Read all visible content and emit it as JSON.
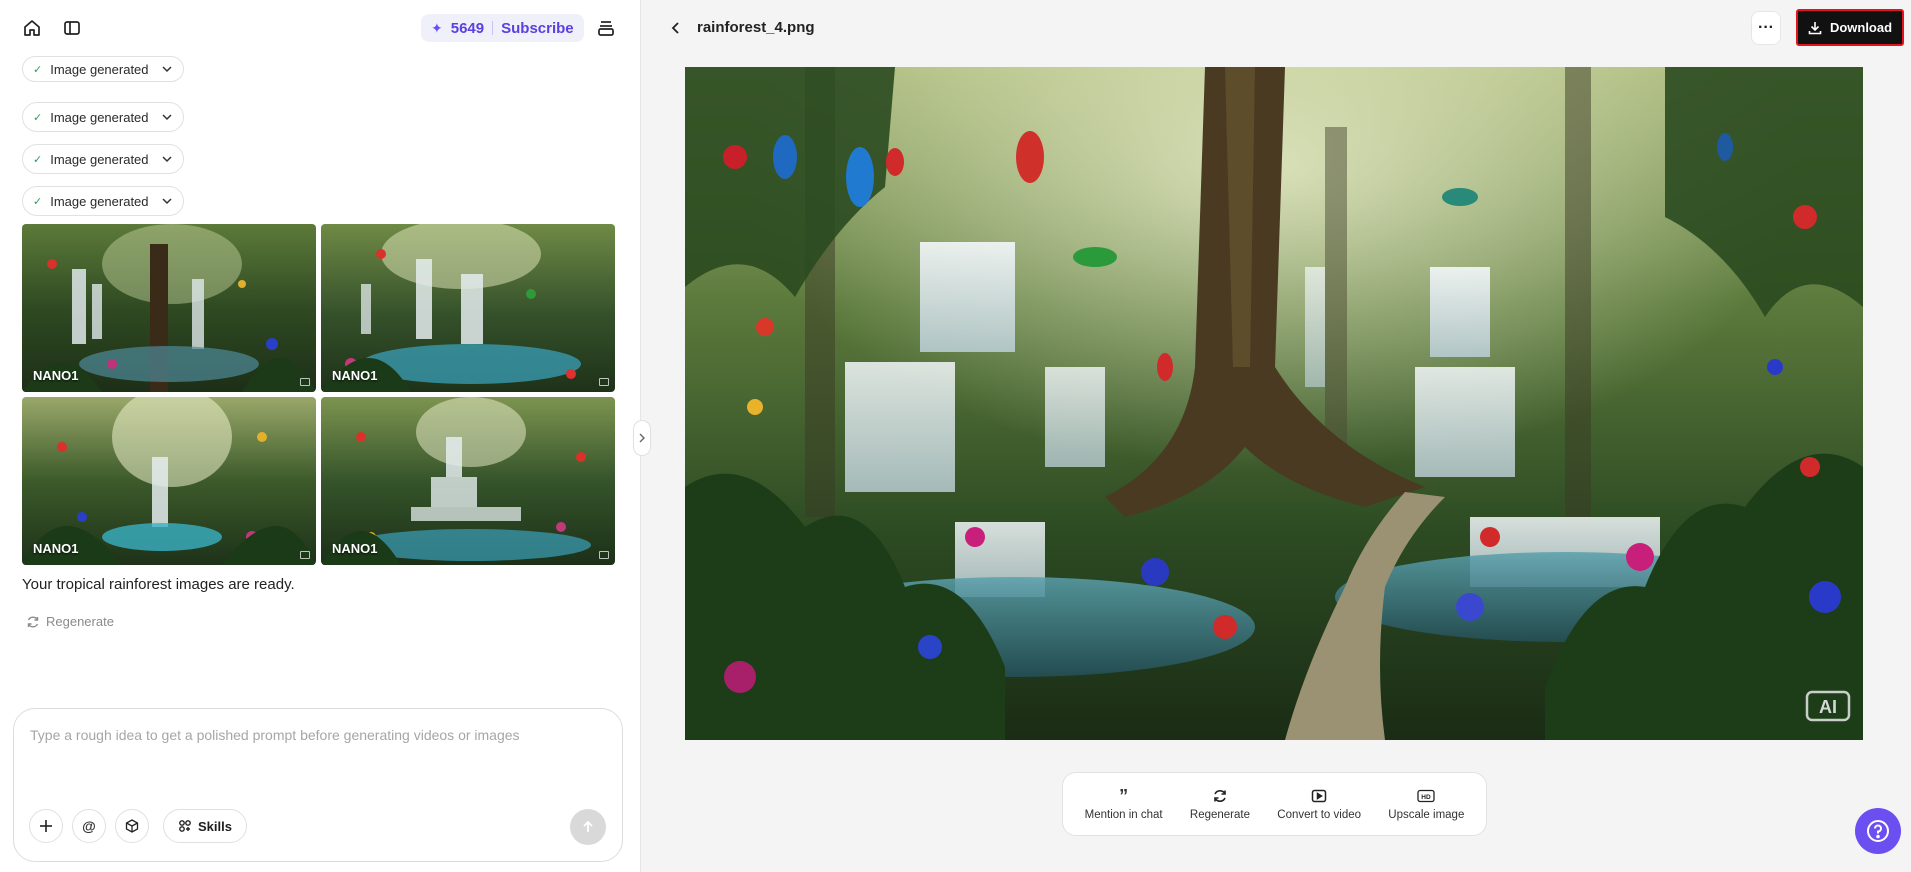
{
  "left_panel": {
    "credits": {
      "count": "5649",
      "subscribe_label": "Subscribe"
    },
    "chips": [
      {
        "label": "Image generated"
      },
      {
        "label": "Image generated"
      },
      {
        "label": "Image generated"
      },
      {
        "label": "Image generated"
      }
    ],
    "images": [
      {
        "label": "NANO1"
      },
      {
        "label": "NANO1"
      },
      {
        "label": "NANO1"
      },
      {
        "label": "NANO1"
      }
    ],
    "result_text": "Your tropical rainforest images are ready.",
    "regenerate_label": "Regenerate",
    "composer": {
      "placeholder": "Type a rough idea to get a polished prompt before generating videos or images",
      "skills_label": "Skills"
    }
  },
  "right_panel": {
    "filename": "rainforest_4.png",
    "download_label": "Download",
    "image_watermark": "AI",
    "actions": [
      {
        "label": "Mention in chat",
        "icon": "quote-icon"
      },
      {
        "label": "Regenerate",
        "icon": "refresh-icon"
      },
      {
        "label": "Convert to video",
        "icon": "video-icon"
      },
      {
        "label": "Upscale image",
        "icon": "hd-icon"
      }
    ]
  },
  "colors": {
    "accent": "#6b4ff0",
    "download_bg": "#111111",
    "download_border": "#e0151e",
    "panel_bg": "#f4f4f4"
  }
}
